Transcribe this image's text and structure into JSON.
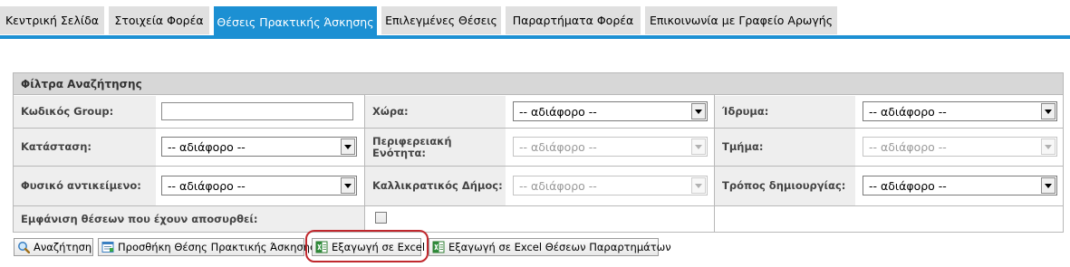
{
  "tabs": [
    {
      "label": "Κεντρική Σελίδα",
      "active": false
    },
    {
      "label": "Στοιχεία Φορέα",
      "active": false
    },
    {
      "label": "Θέσεις Πρακτικής Άσκησης",
      "active": true
    },
    {
      "label": "Επιλεγμένες Θέσεις",
      "active": false
    },
    {
      "label": "Παραρτήματα Φορέα",
      "active": false
    },
    {
      "label": "Επικοινωνία με Γραφείο Αρωγής",
      "active": false
    }
  ],
  "filters": {
    "title": "Φίλτρα Αναζήτησης",
    "group_code_label": "Κωδικός Group:",
    "group_code_value": "",
    "country_label": "Χώρα:",
    "country_value": "-- αδιάφορο --",
    "institution_label": "Ίδρυμα:",
    "institution_value": "-- αδιάφορο --",
    "status_label": "Κατάσταση:",
    "status_value": "-- αδιάφορο --",
    "region_label": "Περιφερειακή Ενότητα:",
    "region_value": "-- αδιάφορο --",
    "department_label": "Τμήμα:",
    "department_value": "-- αδιάφορο --",
    "subject_label": "Φυσικό αντικείμενο:",
    "subject_value": "-- αδιάφορο --",
    "municipality_label": "Καλλικρατικός Δήμος:",
    "municipality_value": "-- αδιάφορο --",
    "creation_label": "Τρόπος δημιουργίας:",
    "creation_value": "-- αδιάφορο --",
    "show_withdrawn_label": "Εμφάνιση θέσεων που έχουν αποσυρθεί:",
    "show_withdrawn_checked": false
  },
  "actions": {
    "search": "Αναζήτηση",
    "add_position": "Προσθήκη Θέσης Πρακτικής Άσκησης",
    "export_excel": "Εξαγωγή σε Excel",
    "export_excel_branches": "Εξαγωγή σε Excel Θέσεων Παραρτημάτων"
  },
  "colors": {
    "accent": "#1c90d3",
    "tab_inactive": "#e0e0e0",
    "highlight": "#c0282d"
  }
}
